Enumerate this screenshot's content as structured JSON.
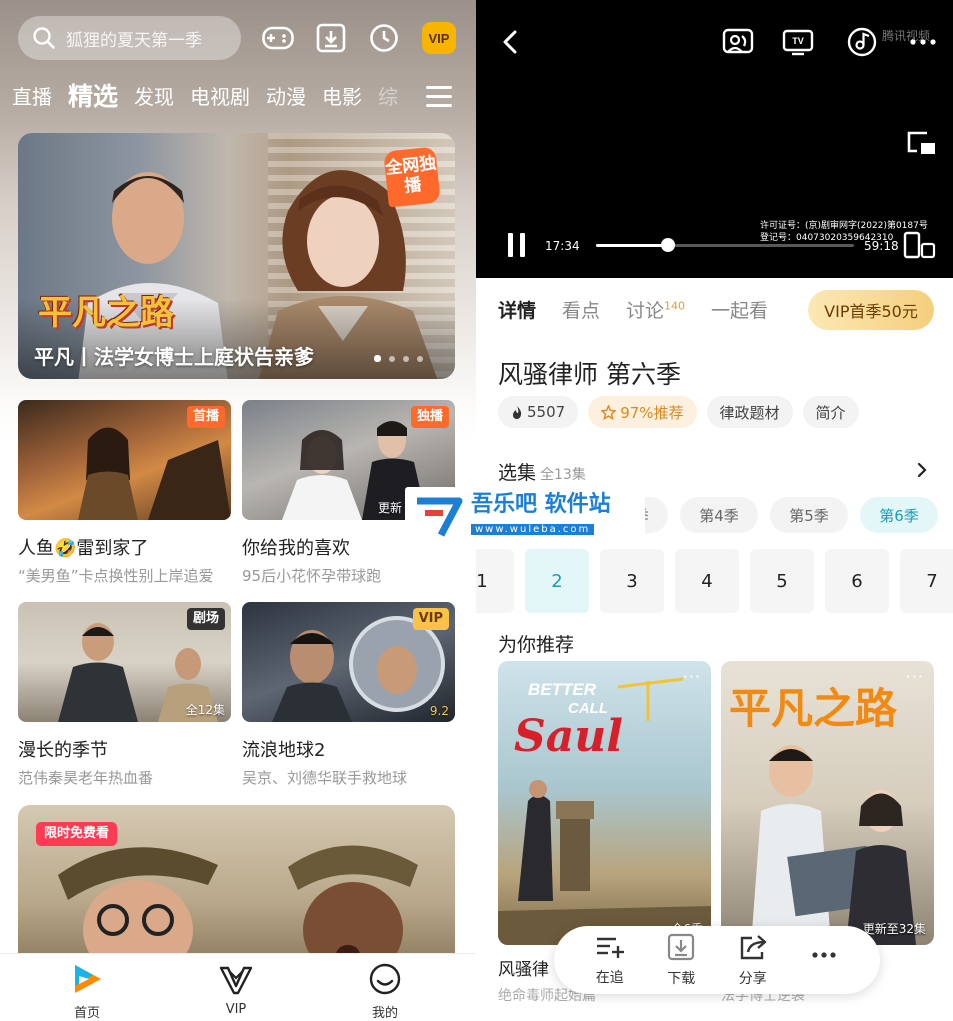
{
  "left": {
    "search": {
      "placeholder": "狐狸的夏天第一季"
    },
    "vip_label": "VIP",
    "nav_tabs": [
      "直播",
      "精选",
      "发现",
      "电视剧",
      "动漫",
      "电影",
      "综"
    ],
    "banner": {
      "tag": "全网独播",
      "logo": "平凡之路",
      "caption": "平凡丨法学女博士上庭状告亲爹"
    },
    "cards": [
      {
        "badge": "首播",
        "title": "人鱼🤣雷到家了",
        "sub": "“美男鱼”卡点换性别上岸追爱"
      },
      {
        "badge": "独播",
        "bottom": "更新",
        "title": "你给我的喜欢",
        "sub": "95后小花怀孕带球跑"
      },
      {
        "badge": "剧场",
        "bottom": "全12集",
        "title": "漫长的季节",
        "sub": "范伟秦昊老年热血番"
      },
      {
        "badge": "VIP",
        "bottom": "9.2",
        "title": "流浪地球2",
        "sub": "吴京、刘德华联手救地球"
      }
    ],
    "big_card_badge": "限时免费看",
    "bottom_nav": [
      {
        "label": "首页",
        "icon": "home-icon"
      },
      {
        "label": "VIP",
        "icon": "vip-crown-icon"
      },
      {
        "label": "我的",
        "icon": "profile-smile-icon"
      }
    ]
  },
  "right": {
    "watermark": "腾讯视频",
    "license": [
      "许可证号：(京)剧审网字(2022)第0187号",
      "登记号：04073020359642310"
    ],
    "time_current": "17:34",
    "time_total": "59:18",
    "progress": 0.28,
    "detail_tabs": [
      {
        "label": "详情"
      },
      {
        "label": "看点"
      },
      {
        "label": "讨论",
        "count": "140"
      },
      {
        "label": "一起看"
      }
    ],
    "vip_button": "VIP首季50元",
    "show_title": "风骚律师 第六季",
    "chips": [
      "5507",
      "97%推荐",
      "律政题材",
      "简介"
    ],
    "episodes_label": "选集",
    "episodes_total": "全13集",
    "seasons": [
      "第3季",
      "第4季",
      "第5季",
      "第6季"
    ],
    "episodes": [
      "1",
      "2",
      "3",
      "4",
      "5",
      "6",
      "7"
    ],
    "recommend_label": "为你推荐",
    "posters": [
      {
        "art": "BETTER CALL Saul",
        "corner": "全6季",
        "title": "风骚律",
        "sub": "绝命毒师起始篇"
      },
      {
        "art": "平凡之路",
        "corner": "更新至32集",
        "title": "",
        "sub": "法学博士逆袭"
      }
    ],
    "actions": [
      "在追",
      "下载",
      "分享",
      ""
    ]
  },
  "overlay": {
    "title": "吾乐吧 软件站",
    "url": "www.wuleba.com"
  }
}
